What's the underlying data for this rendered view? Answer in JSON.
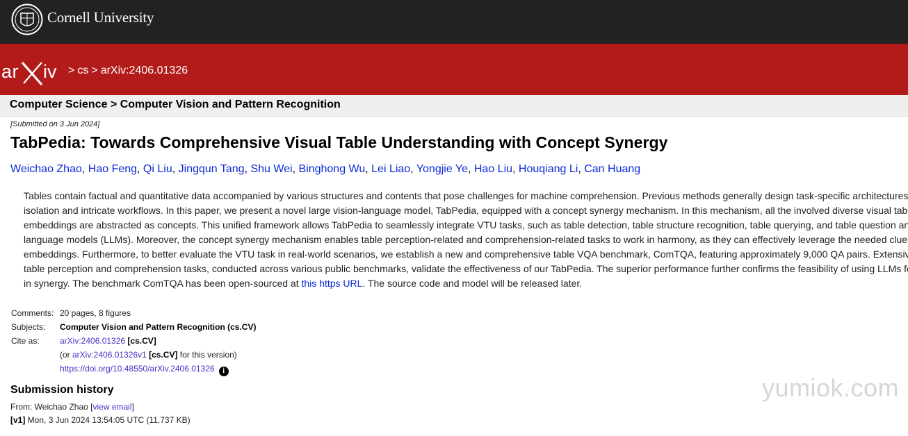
{
  "header": {
    "university": "Cornell University",
    "logo_text": "arXiv",
    "breadcrumb": [
      ">",
      "cs",
      ">",
      "arXiv:2406.01326"
    ]
  },
  "category": "Computer Science > Computer Vision and Pattern Recognition",
  "paper": {
    "dateline": "[Submitted on 3 Jun 2024]",
    "title": "TabPedia: Towards Comprehensive Visual Table Understanding with Concept Synergy",
    "authors": [
      "Weichao Zhao",
      "Hao Feng",
      "Qi Liu",
      "Jingqun Tang",
      "Shu Wei",
      "Binghong Wu",
      "Lei Liao",
      "Yongjie Ye",
      "Hao Liu",
      "Houqiang Li",
      "Can Huang"
    ],
    "author_separator": ", ",
    "abstract_lines": [
      "Tables contain factual and quantitative data accompanied by various structures and contents that pose challenges for machine comprehension. Previous methods generally design task-specific architectures and o",
      "isolation and intricate workflows. In this paper, we present a novel large vision-language model, TabPedia, equipped with a concept synergy mechanism. In this mechanism, all the involved diverse visual table und",
      "embeddings are abstracted as concepts. This unified framework allows TabPedia to seamlessly integrate VTU tasks, such as table detection, table structure recognition, table querying, and table question answerin",
      "language models (LLMs). Moreover, the concept synergy mechanism enables table perception-related and comprehension-related tasks to work in harmony, as they can effectively leverage the needed clues from",
      "embeddings. Furthermore, to better evaluate the VTU task in real-world scenarios, we establish a new and comprehensive table VQA benchmark, ComTQA, featuring approximately 9,000 QA pairs. Extensive qua",
      "table perception and comprehension tasks, conducted across various public benchmarks, validate the effectiveness of our TabPedia. The superior performance further confirms the feasibility of using LLMs for und"
    ],
    "abstract_last": {
      "before": "in synergy. The benchmark ComTQA has been open-sourced at ",
      "link": "this https URL",
      "after": ". The source code and model will be released later."
    }
  },
  "metadata": {
    "comments_label": "Comments:",
    "comments": "20 pages, 8 figures",
    "subjects_label": "Subjects:",
    "subjects": "Computer Vision and Pattern Recognition (cs.CV)",
    "cite_label": "Cite as:",
    "cite_id": "arXiv:2406.01326",
    "cite_cat": "[cs.CV]",
    "cite_or_prefix": "(or ",
    "cite_version_id": "arXiv:2406.01326v1",
    "cite_version_cat": "[cs.CV]",
    "cite_version_suffix": " for this version)",
    "doi": "https://doi.org/10.48550/arXiv.2406.01326",
    "info_icon": "i"
  },
  "history": {
    "title": "Submission history",
    "from_prefix": "From: Weichao Zhao [",
    "view_email": "view email",
    "from_suffix": "]",
    "v1_label": "[v1]",
    "v1_text": " Mon, 3 Jun 2024 13:54:05 UTC (11,737 KB)"
  },
  "watermark": "yumiok.com",
  "colors": {
    "top_bar": "#222222",
    "arxiv_red": "#b31b1b",
    "link_blue": "#0a2ad6",
    "link_purple": "#4b2ec4"
  }
}
